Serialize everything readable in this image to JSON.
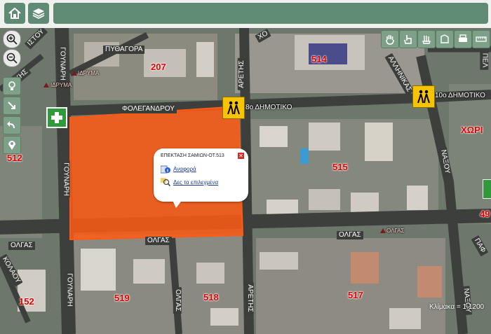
{
  "toolbar": {
    "home_icon": "home-icon",
    "layers_icon": "layers-icon"
  },
  "streets": {
    "foleganrou": "ΦΟΛΕΓΑΝΔΡΟΥ",
    "olgas_center": "ΟΛΓΑΣ",
    "olgas_left": "ΟΛΓΑΣ",
    "olgas_right": "ΟΛΓΑΣ",
    "gounari_top": "ΓΟΥΝΑΡΗ",
    "gounari_mid": "ΓΟΥΝΑΡΗ",
    "gounari_bottom": "ΓΟΥΝΑΡΗ",
    "aretis_top": "ΑΡΕΤΗΣ",
    "aretis_bottom": "ΑΡΕΤΗΣ",
    "naxou_mid": "ΝΑΞΟΥ",
    "naxou_bottom": "ΝΑΞΟΥ",
    "olgas_vertical": "ΟΛΓΑΣ",
    "pythagora": "ΠΥΘΑΓΟΡΑ",
    "thesprotias": "ΠΕΛ",
    "kolaoy": "ΚΟΛΑΟΥ",
    "xo": "ΧΟ",
    "kallinikos": "ΑΛΛΗΝΙΚΑΣ",
    "paf": "ΠΑΦ",
    "kis": "ΚΗΣ",
    "istoy": "ΙΣΤΟΥ"
  },
  "parcels": [
    "207",
    "514",
    "512",
    "515",
    "519",
    "518",
    "517",
    "152",
    "49"
  ],
  "pois": {
    "school_label": "8ο ΔΗΜΟΤΙΚΟ",
    "school2_label": "10ο ΔΗΜΟΤΙΚΟ",
    "idrima": "ΙΔΡΥΜΑ",
    "idrima2": "ΙΔΡΥΜΑ",
    "olgas_poi": "ΟΛΓΑΣ",
    "xori": "ΧΩΡΙ"
  },
  "popup": {
    "title": "ΕΠΕΚΤΑΣΗ ΣΑΜΙΩΝ-ΟΤ.513",
    "report_link": "Αναφορά",
    "selected_link": "Δες τα επιλεγμένα",
    "close_label": "✕"
  },
  "scale": "Κλίμακα = 1:1200",
  "colors": {
    "highlight": "#ff5a14",
    "toolbar": "#5f8b75",
    "parcel_number": "#e00000"
  }
}
